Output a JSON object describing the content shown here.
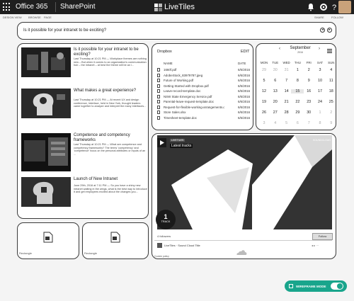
{
  "topbar": {
    "app_name": "Office 365",
    "site_name": "SharePoint",
    "brand": "LiveTiles"
  },
  "subbar": {
    "items": [
      "DESIGN VIEW",
      "BROWSE",
      "PAGE"
    ],
    "share": "SHARE",
    "follow": "FOLLOW"
  },
  "search": {
    "question": "Is it possible for your intranet to be exciting?"
  },
  "news": [
    {
      "title": "Is it possible for your intranet to be exciting?",
      "meta": "Last Thursday at 10:21 PM — Workplace themes are nothing new – But when it comes to an organization's communication hub – the intranet – at best the theme will be an i..."
    },
    {
      "title": "What makes a great experience?",
      "meta": "Last Thursday at 10:21 PM — At recent UX and design conference, Interface, held in New York, thought leaders came together to analyze and interpret the many interfaces..."
    },
    {
      "title": "Competence and competency frameworks",
      "meta": "Last Thursday at 10:21 PM — What are competence and competency frameworks? The terms 'competency' and 'competence' focus on the personal attributes or inputs of an ..."
    },
    {
      "title": "Launch of New Intranet",
      "meta": "June 29th, 2016 at 7:11 PM — So you have a shiny new intranet waiting in the wings, what is the best way to introduce it and get employees excited about the changes you..."
    }
  ],
  "dropbox": {
    "title": "Dropbox",
    "edit": "EDIT",
    "col_name": "NAME",
    "col_date": "DATE",
    "files": [
      {
        "name": "1660f.pdf",
        "date": "6/6/2016"
      },
      {
        "name": "AdobeStock_83979787.jpeg",
        "date": "6/6/2016"
      },
      {
        "name": "Future of Working.pdf",
        "date": "6/6/2016"
      },
      {
        "name": "Getting Started with Dropbox.pdf",
        "date": "6/6/2016"
      },
      {
        "name": "Leave-record-template.doc",
        "date": "6/6/2016"
      },
      {
        "name": "NSW State Emergency Service.pdf",
        "date": "6/6/2016"
      },
      {
        "name": "Parental-leave-request-template.doc",
        "date": "6/6/2016"
      },
      {
        "name": "Request-for-flexible-working-arrangements.doc",
        "date": "6/6/2016"
      },
      {
        "name": "Store Sales.xlsx",
        "date": "6/6/2016"
      },
      {
        "name": "Timesheet-template.doc",
        "date": "6/6/2016"
      }
    ]
  },
  "calendar": {
    "month": "September",
    "year": "2016",
    "prev": "‹",
    "next": "›",
    "weekdays": [
      "MON",
      "TUE",
      "WED",
      "THU",
      "FRI",
      "SAT",
      "SUN"
    ],
    "weeks": [
      [
        "29",
        "30",
        "31",
        "1",
        "2",
        "3",
        "4"
      ],
      [
        "5",
        "6",
        "7",
        "8",
        "9",
        "10",
        "11"
      ],
      [
        "12",
        "13",
        "14",
        "15",
        "16",
        "17",
        "18"
      ],
      [
        "19",
        "20",
        "21",
        "22",
        "23",
        "24",
        "25"
      ],
      [
        "26",
        "27",
        "28",
        "29",
        "30",
        "1",
        "2"
      ],
      [
        "3",
        "4",
        "5",
        "6",
        "7",
        "8",
        "9"
      ]
    ],
    "selected": "15"
  },
  "soundcloud": {
    "user": "LIVETILES",
    "playlist": "Latest tracks",
    "brand": "SOUNDCLOUD",
    "track_count": "1",
    "track_label": "TRACK",
    "followers": "4 followers",
    "follow_btn": "Follow",
    "row_text": "LiveTiles · Sound Cloud Title",
    "cookie": "Cookie policy"
  },
  "rectangles": [
    "Rectangle",
    "Rectangle"
  ],
  "wireframe": {
    "label": "WIREFRAME MODE"
  },
  "colors": {
    "accent": "#19a58c",
    "topbar": "#1f1f1f"
  }
}
